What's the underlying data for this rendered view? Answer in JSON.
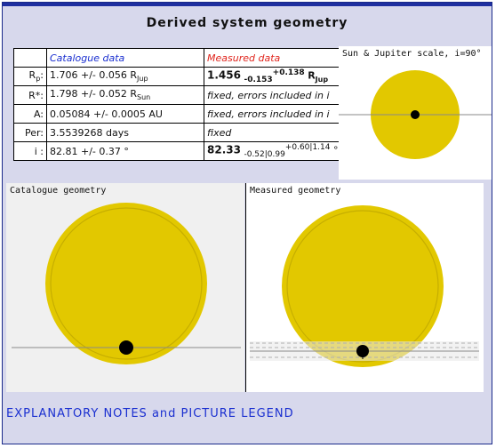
{
  "title": "Derived system geometry",
  "table": {
    "header_catalogue": "Catalogue data",
    "header_measured": "Measured data",
    "rows": [
      {
        "label": "R",
        "label_sub": "p",
        "label_tail": ":",
        "catalogue": "1.706 +/- 0.056 R",
        "catalogue_sub": "Jup",
        "measured_value": "1.456",
        "measured_lo": "-0.153",
        "measured_hi": "+0.138",
        "measured_unit": "R",
        "measured_unit_sub": "Jup"
      },
      {
        "label": "R*:",
        "catalogue": "1.798 +/- 0.052 R",
        "catalogue_sub": "Sun",
        "measured_text": "fixed, errors included in i"
      },
      {
        "label": "A:",
        "catalogue": "0.05084 +/- 0.0005 AU",
        "measured_text": "fixed, errors included in i"
      },
      {
        "label": "Per:",
        "catalogue": "3.5539268 days",
        "measured_text": "fixed"
      },
      {
        "label": "i :",
        "catalogue": "82.81 +/- 0.37 °",
        "measured_value": "82.33",
        "measured_lo": "-0.52|0.99",
        "measured_hi": "+0.60|1.14",
        "measured_unit": "°"
      }
    ]
  },
  "sun_jupiter": {
    "label": "Sun & Jupiter scale, i=90°"
  },
  "catalogue_geometry": {
    "label": "Catalogue geometry"
  },
  "measured_geometry": {
    "label": "Measured geometry"
  },
  "notes_link": "EXPLANATORY NOTES and PICTURE LEGEND",
  "colors": {
    "star_fill": "#e2c800",
    "star_ring": "#c6ae00",
    "planet": "#000000",
    "panel_bg": "#d7d8ec",
    "accent_blue": "#1a2fd0",
    "accent_red": "#e0261e"
  }
}
